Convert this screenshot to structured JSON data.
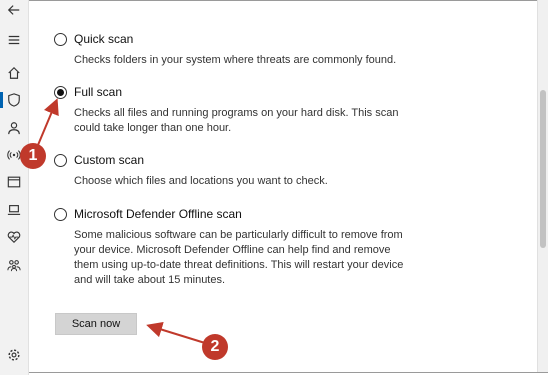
{
  "nav": {
    "icons": [
      "back-icon",
      "hamburger-icon",
      "home-icon",
      "shield-icon",
      "person-icon",
      "wireless-icon",
      "browser-icon",
      "laptop-icon",
      "health-icon",
      "family-icon",
      "gear-icon"
    ]
  },
  "options": [
    {
      "label": "Quick scan",
      "desc": "Checks folders in your system where threats are commonly found.",
      "checked": false
    },
    {
      "label": "Full scan",
      "desc": "Checks all files and running programs on your hard disk. This scan could take longer than one hour.",
      "checked": true
    },
    {
      "label": "Custom scan",
      "desc": "Choose which files and locations you want to check.",
      "checked": false
    },
    {
      "label": "Microsoft Defender Offline scan",
      "desc": "Some malicious software can be particularly difficult to remove from your device. Microsoft Defender Offline can help find and remove them using up-to-date threat definitions. This will restart your device and will take about 15 minutes.",
      "checked": false
    }
  ],
  "scan_button": {
    "label": "Scan now"
  },
  "annotations": {
    "badge1": "1",
    "badge2": "2",
    "color": "#c0392b"
  }
}
